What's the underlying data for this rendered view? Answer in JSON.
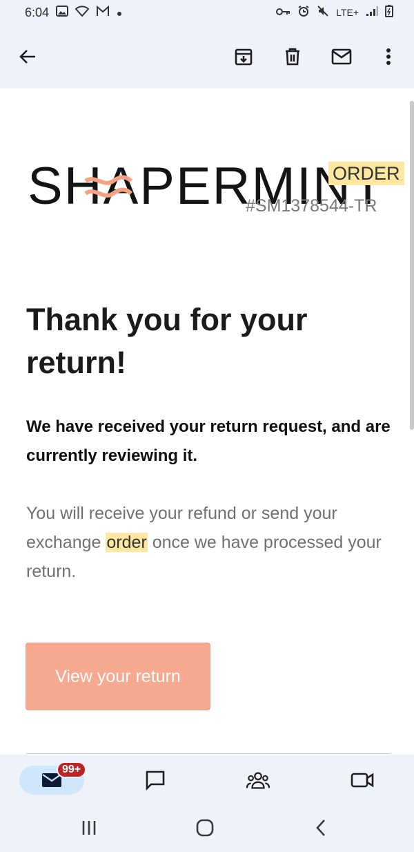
{
  "status_bar": {
    "time": "6:04",
    "network_label": "LTE+"
  },
  "app_bar": {
    "back_icon": "arrow-left-icon",
    "archive_icon": "archive-icon",
    "delete_icon": "trash-icon",
    "mark_unread_icon": "mail-icon",
    "more_icon": "more-vert-icon"
  },
  "email": {
    "brand_logo_text": "SHAPERMINT",
    "order_label": "ORDER",
    "order_number": "#SM1378544-TR",
    "headline": "Thank you for your return!",
    "subheadline": "We have received your return request, and are currently reviewing it.",
    "body_before": "You will receive your refund or send your exchange ",
    "body_highlight": "order",
    "body_after": " once we have processed your return.",
    "cta_label": "View your return"
  },
  "bottom_nav": {
    "mail_badge": "99+",
    "items": [
      "mail-icon",
      "chat-icon",
      "spaces-icon",
      "meet-icon"
    ]
  },
  "system_nav": {
    "recents_icon": "recents-icon",
    "home_icon": "home-icon",
    "back_icon": "back-chevron-icon"
  },
  "colors": {
    "accent": "#f6a98f",
    "highlight": "#fde7a1",
    "badge": "#bb2525",
    "chrome": "#eef2f9"
  }
}
